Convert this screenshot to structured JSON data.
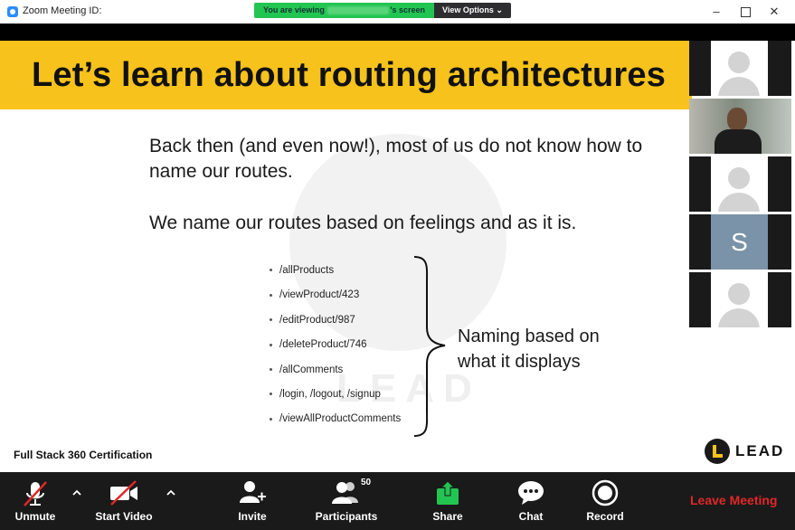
{
  "window": {
    "title": "Zoom Meeting ID:",
    "controls": {
      "minimize": "–",
      "close": "✕"
    }
  },
  "banner": {
    "viewing_prefix": "You are viewing",
    "viewing_suffix": "'s screen",
    "view_options_label": "View Options ⌄"
  },
  "slide": {
    "title": "Let’s learn about routing architectures",
    "paragraph1": "Back then (and even now!), most of us do not know how to name our routes.",
    "paragraph2": "We name our routes based on feelings and as it is.",
    "routes": [
      "/allProducts",
      "/viewProduct/423",
      "/editProduct/987",
      "/deleteProduct/746",
      "/allComments",
      "/login, /logout, /signup",
      "/viewAllProductComments"
    ],
    "brace_label": "Naming based on what it displays",
    "watermark_text": "LEAD",
    "footer_left": "Full Stack 360 Certification",
    "logo_text": "LEAD",
    "accent_color": "#f6c21b"
  },
  "participants": [
    {
      "type": "avatar"
    },
    {
      "type": "video"
    },
    {
      "type": "avatar"
    },
    {
      "type": "initial",
      "initial": "S"
    },
    {
      "type": "avatar"
    }
  ],
  "toolbar": {
    "unmute": "Unmute",
    "start_video": "Start Video",
    "invite": "Invite",
    "participants": "Participants",
    "participants_count": "50",
    "share": "Share",
    "chat": "Chat",
    "record": "Record",
    "leave": "Leave Meeting",
    "leave_color": "#e02828",
    "share_color": "#23c552"
  }
}
